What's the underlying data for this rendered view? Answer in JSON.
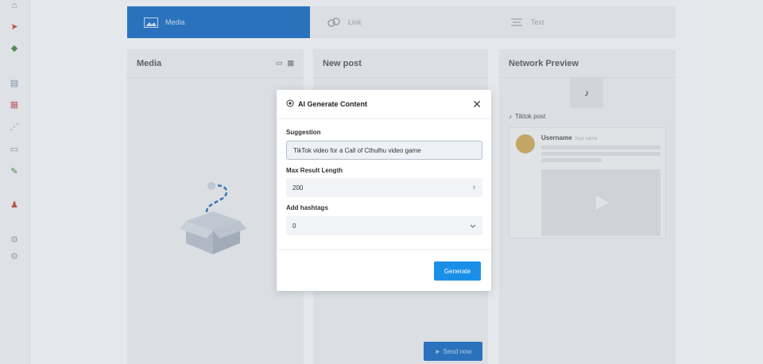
{
  "tabs": [
    {
      "label": "Media",
      "icon": "image-icon"
    },
    {
      "label": "Link",
      "icon": "link-icon"
    },
    {
      "label": "Text",
      "icon": "text-lines-icon"
    }
  ],
  "panels": {
    "media_title": "Media",
    "post_title": "New post",
    "preview_title": "Network Preview",
    "send_label": "Send now"
  },
  "preview": {
    "post_type": "Tiktok post",
    "username": "Username",
    "handle": "Your name"
  },
  "modal": {
    "title": "AI Generate Content",
    "suggestion_label": "Suggestion",
    "suggestion_value": "TikTok video for a Call of Cthulhu video game",
    "max_length_label": "Max Result Length",
    "max_length_value": "200",
    "hashtags_label": "Add hashtags",
    "hashtags_value": "0",
    "generate_label": "Generate"
  },
  "colors": {
    "accent": "#1a8fe8",
    "active_tab": "#1f6fbf"
  }
}
